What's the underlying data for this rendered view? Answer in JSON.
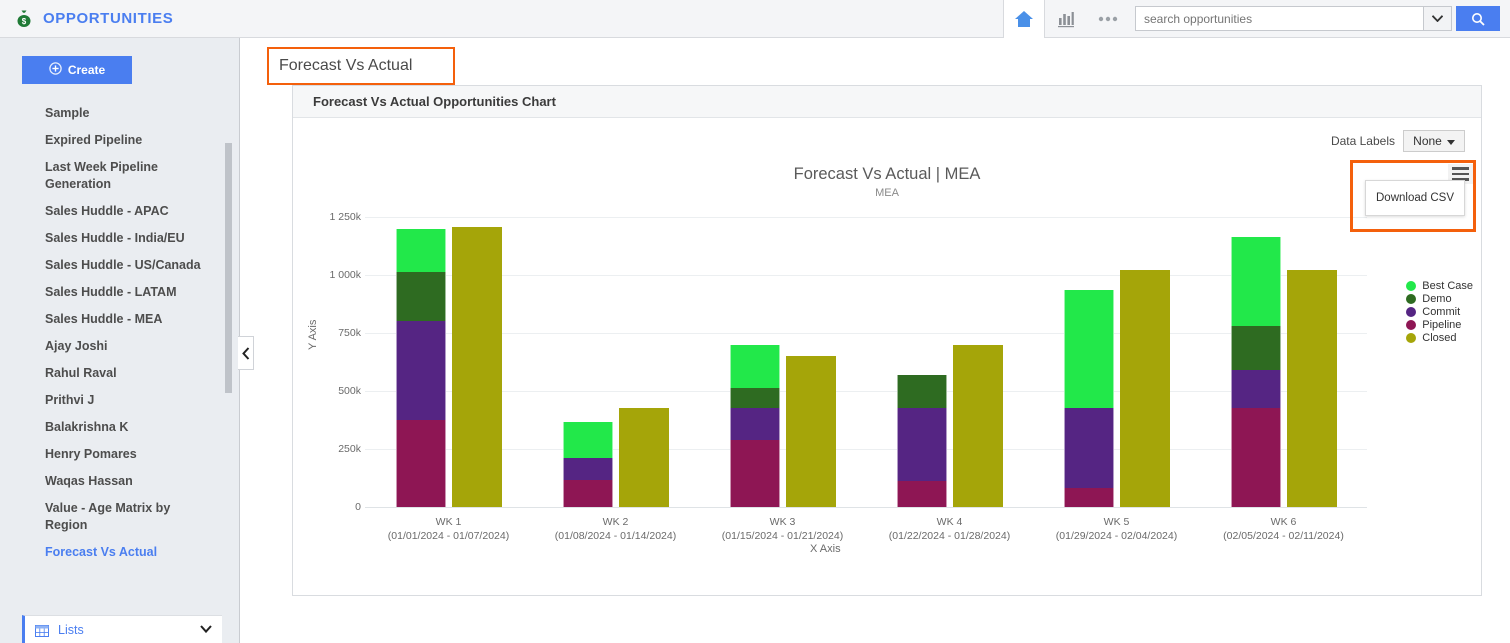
{
  "app": {
    "title": "OPPORTUNITIES",
    "brand_icon": "money-bag-icon",
    "brand_color": "#4a7ef0"
  },
  "toolbar": {
    "home_icon": "home-icon",
    "chart_icon": "bar-chart-icon",
    "more_icon": "ellipsis-icon",
    "search_placeholder": "search opportunities",
    "search_value": "",
    "dropdown_icon": "chevron-down-icon",
    "search_icon": "search-icon"
  },
  "sidebar": {
    "create_label": "Create",
    "create_icon": "plus-circle-icon",
    "items": [
      {
        "label": "Sample",
        "active": false
      },
      {
        "label": "Expired Pipeline",
        "active": false
      },
      {
        "label": "Last Week Pipeline Generation",
        "active": false
      },
      {
        "label": "Sales Huddle - APAC",
        "active": false
      },
      {
        "label": "Sales Huddle - India/EU",
        "active": false
      },
      {
        "label": "Sales Huddle - US/Canada",
        "active": false
      },
      {
        "label": "Sales Huddle - LATAM",
        "active": false
      },
      {
        "label": "Sales Huddle - MEA",
        "active": false
      },
      {
        "label": "Ajay Joshi",
        "active": false
      },
      {
        "label": "Rahul Raval",
        "active": false
      },
      {
        "label": "Prithvi J",
        "active": false
      },
      {
        "label": "Balakrishna K",
        "active": false
      },
      {
        "label": "Henry Pomares",
        "active": false
      },
      {
        "label": "Waqas Hassan",
        "active": false
      },
      {
        "label": "Value - Age Matrix by Region",
        "active": false
      },
      {
        "label": "Forecast Vs Actual",
        "active": true
      }
    ],
    "lists_label": "Lists",
    "lists_icon": "grid-icon",
    "lists_caret_icon": "chevron-down-icon",
    "collapse_icon": "chevron-left-icon"
  },
  "main": {
    "page_title": "Forecast Vs Actual",
    "panel_header": "Forecast Vs Actual Opportunities Chart",
    "data_labels_text": "Data Labels",
    "data_labels_value": "None",
    "data_labels_caret": "caret-down-icon",
    "menu_icon": "hamburger-menu-icon",
    "download_csv_label": "Download CSV",
    "highlight_color": "#f4600c"
  },
  "chart_data": {
    "type": "bar",
    "subtype": "stacked-plus-comparison",
    "title": "Forecast Vs Actual | MEA",
    "subtitle": "MEA",
    "xlabel": "X Axis",
    "ylabel": "Y Axis",
    "ylim": [
      0,
      1250000
    ],
    "yticks": [
      0,
      250000,
      500000,
      750000,
      1000000,
      1250000
    ],
    "ytick_labels": [
      "0",
      "250k",
      "500k",
      "750k",
      "1 000k",
      "1 250k"
    ],
    "grid": true,
    "legend_position": "right",
    "categories": [
      "WK 1\n(01/01/2024 - 01/07/2024)",
      "WK 2\n(01/08/2024 - 01/14/2024)",
      "WK 3\n(01/15/2024 - 01/21/2024)",
      "WK 4\n(01/22/2024 - 01/28/2024)",
      "WK 5\n(01/29/2024 - 02/04/2024)",
      "WK 6\n(02/05/2024 - 02/11/2024)"
    ],
    "category_lines": [
      [
        "WK 1",
        "(01/01/2024 - 01/07/2024)"
      ],
      [
        "WK 2",
        "(01/08/2024 - 01/14/2024)"
      ],
      [
        "WK 3",
        "(01/15/2024 - 01/21/2024)"
      ],
      [
        "WK 4",
        "(01/22/2024 - 01/28/2024)"
      ],
      [
        "WK 5",
        "(01/29/2024 - 02/04/2024)"
      ],
      [
        "WK 6",
        "(02/05/2024 - 02/11/2024)"
      ]
    ],
    "series": [
      {
        "name": "Pipeline",
        "color": "#8e1654",
        "stack": "forecast",
        "values": [
          375000,
          115000,
          290000,
          110000,
          80000,
          425000
        ]
      },
      {
        "name": "Commit",
        "color": "#552583",
        "stack": "forecast",
        "values": [
          425000,
          95000,
          135000,
          315000,
          345000,
          165000
        ]
      },
      {
        "name": "Demo",
        "color": "#2e6b21",
        "stack": "forecast",
        "values": [
          215000,
          0,
          90000,
          145000,
          0,
          190000
        ]
      },
      {
        "name": "Best Case",
        "color": "#22e84a",
        "stack": "forecast",
        "values": [
          185000,
          155000,
          185000,
          0,
          510000,
          385000
        ]
      },
      {
        "name": "Closed",
        "color": "#a5a509",
        "stack": "actual",
        "values": [
          1205000,
          425000,
          650000,
          700000,
          1020000,
          1020000
        ]
      }
    ],
    "legend": [
      {
        "label": "Best Case",
        "color": "#22e84a"
      },
      {
        "label": "Demo",
        "color": "#2e6b21"
      },
      {
        "label": "Commit",
        "color": "#552583"
      },
      {
        "label": "Pipeline",
        "color": "#8e1654"
      },
      {
        "label": "Closed",
        "color": "#a5a509"
      }
    ]
  }
}
